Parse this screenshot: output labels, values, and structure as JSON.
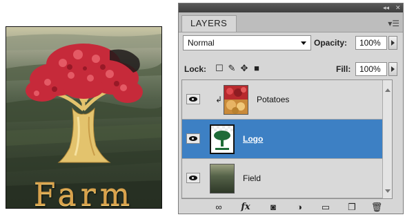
{
  "artwork": {
    "title": "Farm",
    "colors": {
      "tree_foliage": "#c62a3a",
      "trunk": "#e6c46a",
      "title_text": "#d9a24c"
    }
  },
  "panel": {
    "tab_label": "LAYERS",
    "window_controls": [
      "collapse-icon",
      "close-icon"
    ],
    "menu_icon": "panel-menu-icon",
    "blend_mode": "Normal",
    "opacity_label": "Opacity:",
    "opacity_value": "100%",
    "lock_label": "Lock:",
    "lock_icons": [
      "lock-transparent-pixels-icon",
      "lock-image-pixels-icon",
      "lock-position-icon",
      "lock-all-icon"
    ],
    "fill_label": "Fill:",
    "fill_value": "100%",
    "layers": [
      {
        "name": "Potatoes",
        "visible": true,
        "clipped": true,
        "selected": false,
        "thumbnail": "potatoes-thumbnail"
      },
      {
        "name": "Logo",
        "visible": true,
        "clipped": false,
        "selected": true,
        "thumbnail": "logo-thumbnail"
      },
      {
        "name": "Field",
        "visible": true,
        "clipped": false,
        "selected": false,
        "thumbnail": "field-thumbnail"
      }
    ],
    "footer_icons": [
      "link-layers-icon",
      "fx-icon",
      "add-mask-icon",
      "adjustment-layer-icon",
      "new-group-icon",
      "new-layer-icon",
      "delete-layer-icon"
    ],
    "footer_labels": {
      "fx": "fx"
    },
    "selection_color": "#3d80c4"
  }
}
